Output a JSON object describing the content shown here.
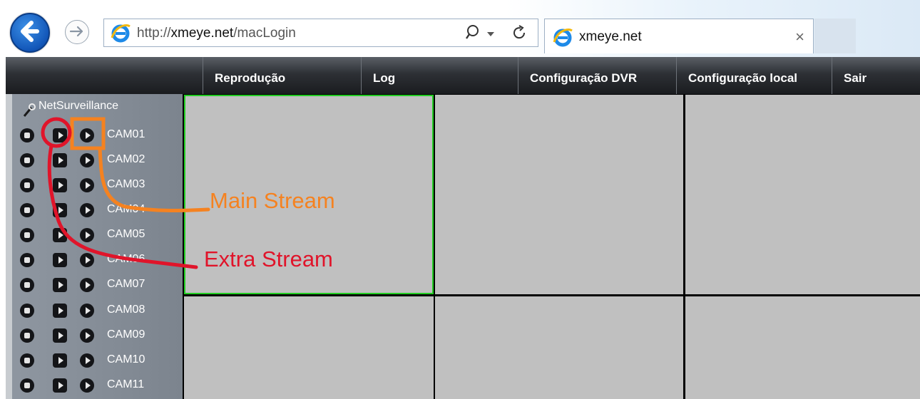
{
  "browser": {
    "url_prefix": "http://",
    "url_domain": "xmeye.net",
    "url_path": "/macLogin",
    "tab_title": "xmeye.net",
    "tab_close": "×",
    "search_icon": "search-icon",
    "refresh_icon": "refresh-icon"
  },
  "menu": {
    "items": [
      {
        "label": "Reprodução"
      },
      {
        "label": "Log"
      },
      {
        "label": "Configuração DVR"
      },
      {
        "label": "Configuração local"
      },
      {
        "label": "Sair"
      }
    ]
  },
  "sidebar": {
    "device": "NetSurveillance",
    "cameras": [
      {
        "label": "CAM01"
      },
      {
        "label": "CAM02"
      },
      {
        "label": "CAM03"
      },
      {
        "label": "CAM04"
      },
      {
        "label": "CAM05"
      },
      {
        "label": "CAM06"
      },
      {
        "label": "CAM07"
      },
      {
        "label": "CAM08"
      },
      {
        "label": "CAM09"
      },
      {
        "label": "CAM10"
      },
      {
        "label": "CAM11"
      }
    ]
  },
  "annotations": {
    "main_stream": "Main Stream",
    "extra_stream": "Extra Stream"
  },
  "colors": {
    "main_stream": "#f58220",
    "extra_stream": "#e0142a",
    "selected_cell_border": "#22cc22"
  }
}
